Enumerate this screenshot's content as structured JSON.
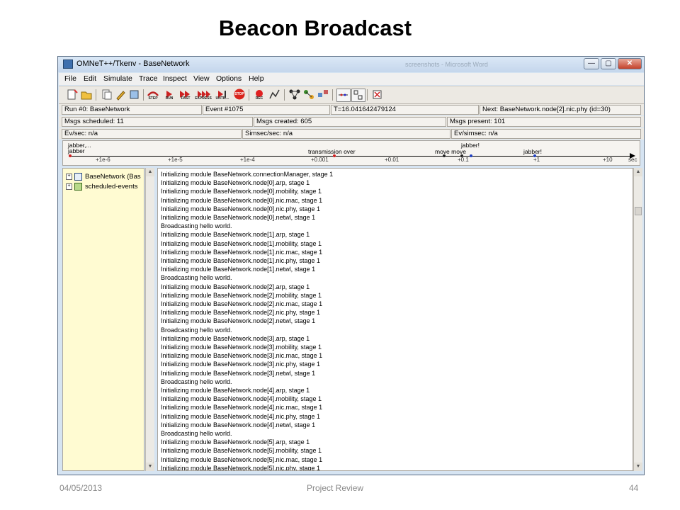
{
  "slide": {
    "title": "Beacon Broadcast",
    "footer_date": "04/05/2013",
    "footer_center": "Project Review",
    "footer_page": "44"
  },
  "window": {
    "title": "OMNeT++/Tkenv - BaseNetwork",
    "blurred_title": "screenshots - Microsoft Word",
    "min_label": "—",
    "max_label": "▢",
    "close_label": "✕"
  },
  "menu": [
    "File",
    "Edit",
    "Simulate",
    "Trace",
    "Inspect",
    "View",
    "Options",
    "Help"
  ],
  "toolbar": {
    "step": "STEP",
    "run": "RUN",
    "fast": "FAST",
    "express": "EXPRESS",
    "until": "UNTIL...",
    "stop": "STOP",
    "rec": "REC"
  },
  "status": {
    "run": "Run #0: BaseNetwork",
    "event": "Event #1075",
    "time": "T=16.041642479124",
    "next": "Next: BaseNetwork.node[2].nic.phy (id=30)",
    "msgs_scheduled": "Msgs scheduled: 11",
    "msgs_created": "Msgs created: 605",
    "msgs_present": "Msgs present: 101",
    "ev_sec": "Ev/sec: n/a",
    "simsec_sec": "Simsec/sec: n/a",
    "ev_simsec": "Ev/simsec: n/a"
  },
  "timeline": {
    "label_jabber_top": "jabber,...",
    "label_jabber": "jabber",
    "label_transmission": "transmission over",
    "label_move": "move move",
    "label_jabber2": "jabber!",
    "label_jabber3": "jabber!",
    "ticks": [
      "+1e-6",
      "+1e-5",
      "+1e-4",
      "+0.001",
      "+0.01",
      "+0.1",
      "+1",
      "+10",
      "sec"
    ]
  },
  "tree": {
    "items": [
      "BaseNetwork (Bas",
      "scheduled-events"
    ],
    "expander": "+"
  },
  "log_lines": [
    "Initializing module BaseNetwork.connectionManager, stage 1",
    "Initializing module BaseNetwork.node[0].arp, stage 1",
    "Initializing module BaseNetwork.node[0].mobility, stage 1",
    "Initializing module BaseNetwork.node[0].nic.mac, stage 1",
    "Initializing module BaseNetwork.node[0].nic.phy, stage 1",
    "Initializing module BaseNetwork.node[0].netwl, stage 1",
    "Broadcasting hello world.",
    "Initializing module BaseNetwork.node[1].arp, stage 1",
    "Initializing module BaseNetwork.node[1].mobility, stage 1",
    "Initializing module BaseNetwork.node[1].nic.mac, stage 1",
    "Initializing module BaseNetwork.node[1].nic.phy, stage 1",
    "Initializing module BaseNetwork.node[1].netwl, stage 1",
    "Broadcasting hello world.",
    "Initializing module BaseNetwork.node[2].arp, stage 1",
    "Initializing module BaseNetwork.node[2].mobility, stage 1",
    "Initializing module BaseNetwork.node[2].nic.mac, stage 1",
    "Initializing module BaseNetwork.node[2].nic.phy, stage 1",
    "Initializing module BaseNetwork.node[2].netwl, stage 1",
    "Broadcasting hello world.",
    "Initializing module BaseNetwork.node[3].arp, stage 1",
    "Initializing module BaseNetwork.node[3].mobility, stage 1",
    "Initializing module BaseNetwork.node[3].nic.mac, stage 1",
    "Initializing module BaseNetwork.node[3].nic.phy, stage 1",
    "Initializing module BaseNetwork.node[3].netwl, stage 1",
    "Broadcasting hello world.",
    "Initializing module BaseNetwork.node[4].arp, stage 1",
    "Initializing module BaseNetwork.node[4].mobility, stage 1",
    "Initializing module BaseNetwork.node[4].nic.mac, stage 1",
    "Initializing module BaseNetwork.node[4].nic.phy, stage 1",
    "Initializing module BaseNetwork.node[4].netwl, stage 1",
    "Broadcasting hello world.",
    "Initializing module BaseNetwork.node[5].arp, stage 1",
    "Initializing module BaseNetwork.node[5].mobility, stage 1",
    "Initializing module BaseNetwork.node[5].nic.mac, stage 1",
    "Initializing module BaseNetwork.node[5].nic.phy, stage 1"
  ],
  "colors": {
    "tree_bg": "#fffbd2",
    "stop_red": "#d9251d",
    "rec_red": "#e02020",
    "event_dot_red": "#d02020",
    "event_dot_blue": "#2040c0"
  }
}
